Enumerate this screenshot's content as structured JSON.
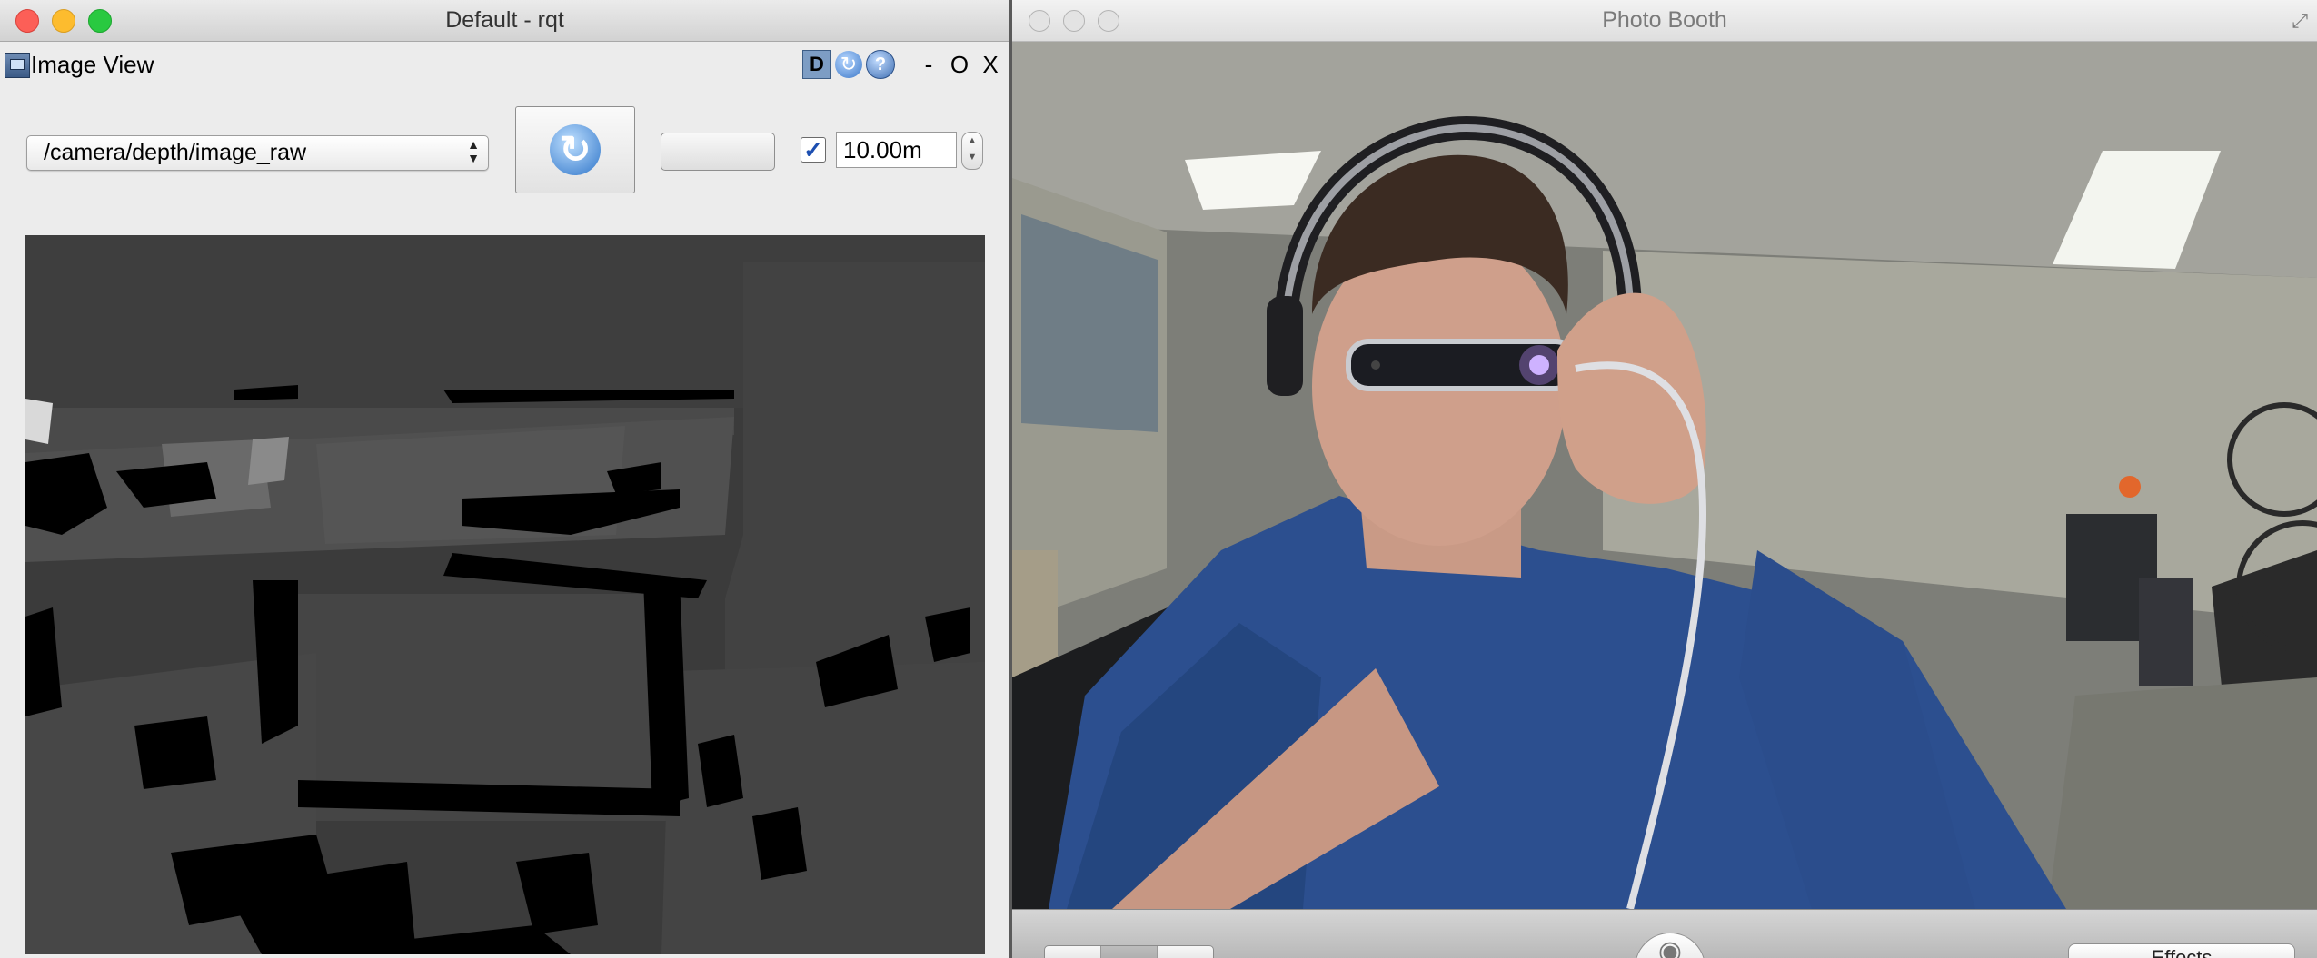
{
  "rqt": {
    "window_title": "Default - rqt",
    "plugin_title": "Image View",
    "plugin_controls": {
      "d_label": "D",
      "minimize": "-",
      "restore": "O",
      "close": "X"
    },
    "topic": "/camera/depth/image_raw",
    "max_range_checked": true,
    "max_range_value": "10.00m"
  },
  "photobooth": {
    "window_title": "Photo Booth",
    "effects_label": "Effects"
  },
  "icons": {
    "rqt_plugin": "image-view-icon",
    "dock": "dock-icon",
    "reload": "reload-icon",
    "help": "help-icon",
    "refresh": "refresh-icon",
    "checkbox": "checkmark-icon",
    "stepper": "stepper-icon",
    "shutter": "camera-icon",
    "fullscreen": "fullscreen-icon"
  },
  "colors": {
    "close": "#fc5f57",
    "minimize": "#fdbc2e",
    "zoom": "#29c940",
    "accent": "#3c78c8"
  }
}
